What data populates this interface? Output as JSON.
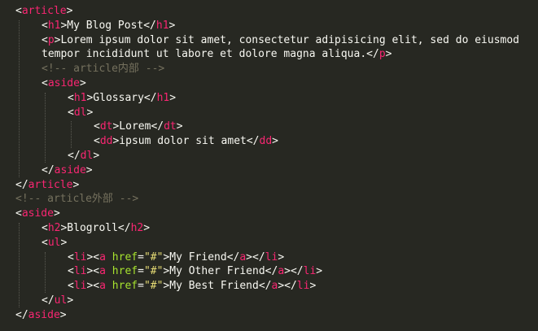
{
  "theme": {
    "background": "#272822",
    "text": "#f8f8f2",
    "tag": "#f92672",
    "attribute": "#a6e22e",
    "string": "#e6db74",
    "comment": "#75715e"
  },
  "code_lines": [
    {
      "indent": 0,
      "tokens": [
        {
          "t": "txt",
          "v": "<"
        },
        {
          "t": "tag",
          "v": "article"
        },
        {
          "t": "txt",
          "v": ">"
        }
      ]
    },
    {
      "indent": 1,
      "tokens": [
        {
          "t": "txt",
          "v": "<"
        },
        {
          "t": "tag",
          "v": "h1"
        },
        {
          "t": "txt",
          "v": ">My Blog Post</"
        },
        {
          "t": "tag",
          "v": "h1"
        },
        {
          "t": "txt",
          "v": ">"
        }
      ]
    },
    {
      "indent": 1,
      "tokens": [
        {
          "t": "txt",
          "v": "<"
        },
        {
          "t": "tag",
          "v": "p"
        },
        {
          "t": "txt",
          "v": ">Lorem ipsum dolor sit amet, consectetur adipisicing elit, sed do eiusmod"
        }
      ]
    },
    {
      "indent": 1,
      "tokens": [
        {
          "t": "txt",
          "v": "tempor incididunt ut labore et dolore magna aliqua.</"
        },
        {
          "t": "tag",
          "v": "p"
        },
        {
          "t": "txt",
          "v": ">"
        }
      ]
    },
    {
      "indent": 1,
      "tokens": [
        {
          "t": "cm",
          "v": "<!-- article内部 -->"
        }
      ]
    },
    {
      "indent": 1,
      "tokens": [
        {
          "t": "txt",
          "v": "<"
        },
        {
          "t": "tag",
          "v": "aside"
        },
        {
          "t": "txt",
          "v": ">"
        }
      ]
    },
    {
      "indent": 2,
      "tokens": [
        {
          "t": "txt",
          "v": "<"
        },
        {
          "t": "tag",
          "v": "h1"
        },
        {
          "t": "txt",
          "v": ">Glossary</"
        },
        {
          "t": "tag",
          "v": "h1"
        },
        {
          "t": "txt",
          "v": ">"
        }
      ]
    },
    {
      "indent": 2,
      "tokens": [
        {
          "t": "txt",
          "v": "<"
        },
        {
          "t": "tag",
          "v": "dl"
        },
        {
          "t": "txt",
          "v": ">"
        }
      ]
    },
    {
      "indent": 3,
      "tokens": [
        {
          "t": "txt",
          "v": "<"
        },
        {
          "t": "tag",
          "v": "dt"
        },
        {
          "t": "txt",
          "v": ">Lorem</"
        },
        {
          "t": "tag",
          "v": "dt"
        },
        {
          "t": "txt",
          "v": ">"
        }
      ]
    },
    {
      "indent": 3,
      "tokens": [
        {
          "t": "txt",
          "v": "<"
        },
        {
          "t": "tag",
          "v": "dd"
        },
        {
          "t": "txt",
          "v": ">ipsum dolor sit amet</"
        },
        {
          "t": "tag",
          "v": "dd"
        },
        {
          "t": "txt",
          "v": ">"
        }
      ]
    },
    {
      "indent": 2,
      "tokens": [
        {
          "t": "txt",
          "v": "</"
        },
        {
          "t": "tag",
          "v": "dl"
        },
        {
          "t": "txt",
          "v": ">"
        }
      ]
    },
    {
      "indent": 1,
      "tokens": [
        {
          "t": "txt",
          "v": "</"
        },
        {
          "t": "tag",
          "v": "aside"
        },
        {
          "t": "txt",
          "v": ">"
        }
      ]
    },
    {
      "indent": 0,
      "tokens": [
        {
          "t": "txt",
          "v": "</"
        },
        {
          "t": "tag",
          "v": "article"
        },
        {
          "t": "txt",
          "v": ">"
        }
      ]
    },
    {
      "indent": 0,
      "tokens": [
        {
          "t": "cm",
          "v": "<!-- article外部 -->"
        }
      ]
    },
    {
      "indent": 0,
      "tokens": [
        {
          "t": "txt",
          "v": "<"
        },
        {
          "t": "tag",
          "v": "aside"
        },
        {
          "t": "txt",
          "v": ">"
        }
      ]
    },
    {
      "indent": 1,
      "tokens": [
        {
          "t": "txt",
          "v": "<"
        },
        {
          "t": "tag",
          "v": "h2"
        },
        {
          "t": "txt",
          "v": ">Blogroll</"
        },
        {
          "t": "tag",
          "v": "h2"
        },
        {
          "t": "txt",
          "v": ">"
        }
      ]
    },
    {
      "indent": 1,
      "tokens": [
        {
          "t": "txt",
          "v": "<"
        },
        {
          "t": "tag",
          "v": "ul"
        },
        {
          "t": "txt",
          "v": ">"
        }
      ]
    },
    {
      "indent": 2,
      "tokens": [
        {
          "t": "txt",
          "v": "<"
        },
        {
          "t": "tag",
          "v": "li"
        },
        {
          "t": "txt",
          "v": "><"
        },
        {
          "t": "tag",
          "v": "a"
        },
        {
          "t": "txt",
          "v": " "
        },
        {
          "t": "attr",
          "v": "href"
        },
        {
          "t": "txt",
          "v": "="
        },
        {
          "t": "str",
          "v": "\"#\""
        },
        {
          "t": "txt",
          "v": ">My Friend</"
        },
        {
          "t": "tag",
          "v": "a"
        },
        {
          "t": "txt",
          "v": "></"
        },
        {
          "t": "tag",
          "v": "li"
        },
        {
          "t": "txt",
          "v": ">"
        }
      ]
    },
    {
      "indent": 2,
      "tokens": [
        {
          "t": "txt",
          "v": "<"
        },
        {
          "t": "tag",
          "v": "li"
        },
        {
          "t": "txt",
          "v": "><"
        },
        {
          "t": "tag",
          "v": "a"
        },
        {
          "t": "txt",
          "v": " "
        },
        {
          "t": "attr",
          "v": "href"
        },
        {
          "t": "txt",
          "v": "="
        },
        {
          "t": "str",
          "v": "\"#\""
        },
        {
          "t": "txt",
          "v": ">My Other Friend</"
        },
        {
          "t": "tag",
          "v": "a"
        },
        {
          "t": "txt",
          "v": "></"
        },
        {
          "t": "tag",
          "v": "li"
        },
        {
          "t": "txt",
          "v": ">"
        }
      ]
    },
    {
      "indent": 2,
      "tokens": [
        {
          "t": "txt",
          "v": "<"
        },
        {
          "t": "tag",
          "v": "li"
        },
        {
          "t": "txt",
          "v": "><"
        },
        {
          "t": "tag",
          "v": "a"
        },
        {
          "t": "txt",
          "v": " "
        },
        {
          "t": "attr",
          "v": "href"
        },
        {
          "t": "txt",
          "v": "="
        },
        {
          "t": "str",
          "v": "\"#\""
        },
        {
          "t": "txt",
          "v": ">My Best Friend</"
        },
        {
          "t": "tag",
          "v": "a"
        },
        {
          "t": "txt",
          "v": "></"
        },
        {
          "t": "tag",
          "v": "li"
        },
        {
          "t": "txt",
          "v": ">"
        }
      ]
    },
    {
      "indent": 1,
      "tokens": [
        {
          "t": "txt",
          "v": "</"
        },
        {
          "t": "tag",
          "v": "ul"
        },
        {
          "t": "txt",
          "v": ">"
        }
      ]
    },
    {
      "indent": 0,
      "tokens": [
        {
          "t": "txt",
          "v": "</"
        },
        {
          "t": "tag",
          "v": "aside"
        },
        {
          "t": "txt",
          "v": ">"
        }
      ]
    }
  ]
}
